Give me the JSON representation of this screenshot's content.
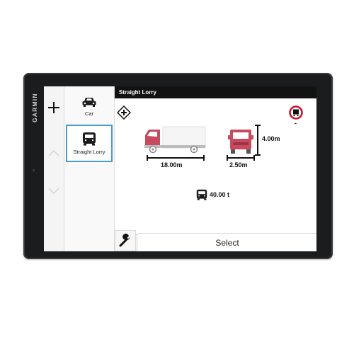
{
  "device": {
    "brand": "GARMIN"
  },
  "sidebar": {
    "profiles": [
      {
        "label": "Car",
        "icon": "car-icon",
        "selected": false
      },
      {
        "label": "Straight Lorry",
        "icon": "lorry-icon",
        "selected": true
      }
    ]
  },
  "header": {
    "title": "Straight Lorry"
  },
  "vehicle": {
    "length": "18.00m",
    "width": "2.50m",
    "height": "4.00m",
    "weight": "40.00 t",
    "restriction_value": "-"
  },
  "footer": {
    "select_label": "Select"
  },
  "colors": {
    "lorry": "#c74a5e",
    "title_bar": "#121212",
    "selected_border": "#4a9bd1"
  }
}
